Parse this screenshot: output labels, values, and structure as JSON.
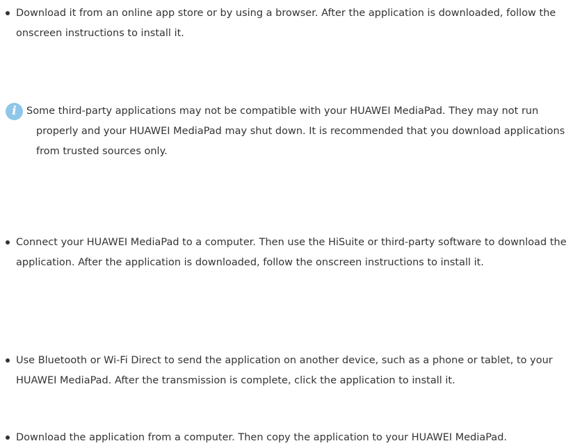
{
  "items": [
    {
      "type": "bullet",
      "text": "Download it from an online app store or by using a browser. After the application is downloaded, follow the onscreen instructions to install it."
    },
    {
      "type": "note",
      "icon": "info-icon",
      "icon_glyph": "i",
      "text": "Some third-party applications may not be compatible with your HUAWEI MediaPad. They may not run properly and your HUAWEI MediaPad may shut down. It is recommended that you download applications from trusted sources only."
    },
    {
      "type": "bullet",
      "text": "Connect your HUAWEI MediaPad to a computer. Then use the HiSuite or third-party software to download the application. After the application is downloaded, follow the onscreen instructions to install it."
    },
    {
      "type": "bullet",
      "text": "Use Bluetooth or Wi-Fi Direct to send the application on another device, such as a phone or tablet, to your HUAWEI MediaPad. After the transmission is complete, click the application to install it."
    },
    {
      "type": "bullet",
      "text": "Download the application from a computer. Then copy the application to your HUAWEI MediaPad."
    }
  ],
  "colors": {
    "text": "#333333",
    "note_icon_bg": "#8ec7e9"
  }
}
